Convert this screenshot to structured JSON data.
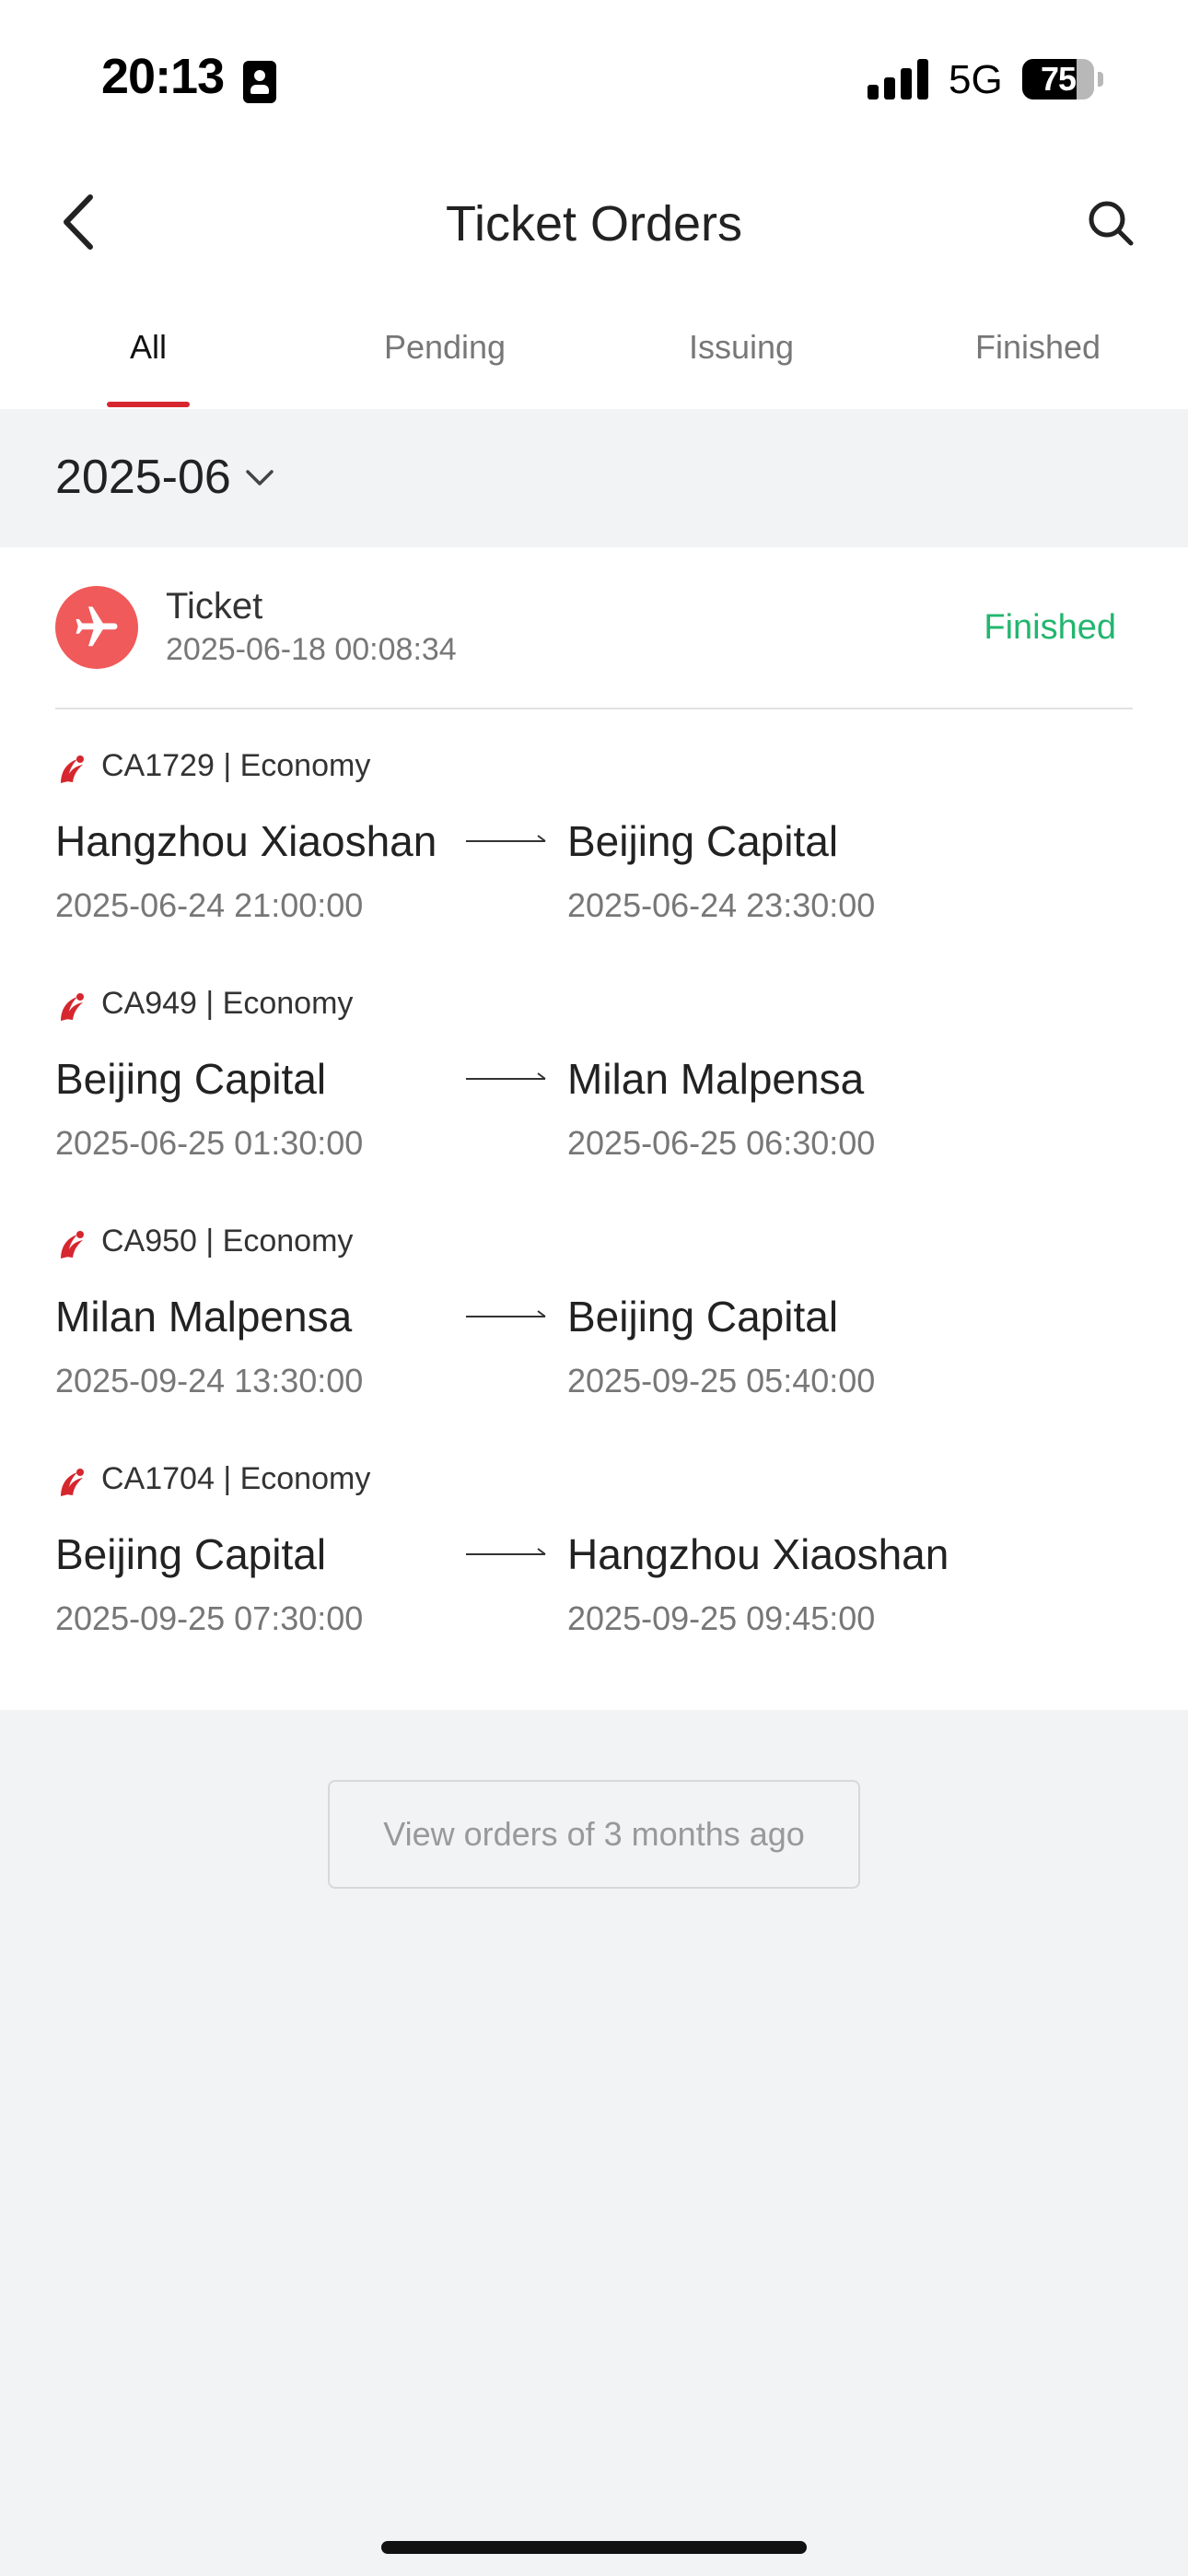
{
  "status_bar": {
    "time": "20:13",
    "network": "5G",
    "battery_level": "75",
    "battery_fraction": 0.75,
    "signal_bars": 4
  },
  "nav": {
    "title": "Ticket Orders",
    "back_icon": "chevron-left-icon",
    "search_icon": "search-icon"
  },
  "tabs": [
    {
      "label": "All",
      "active": true
    },
    {
      "label": "Pending",
      "active": false
    },
    {
      "label": "Issuing",
      "active": false
    },
    {
      "label": "Finished",
      "active": false
    }
  ],
  "month_selector": {
    "value": "2025-06",
    "icon": "chevron-down-icon"
  },
  "order": {
    "icon": "airplane-icon",
    "title": "Ticket",
    "created_time": "2025-06-18 00:08:34",
    "status": "Finished",
    "segments": [
      {
        "flight": "CA1729 | Economy",
        "from": "Hangzhou Xiaoshan",
        "to": "Beijing Capital",
        "dep_time": "2025-06-24 21:00:00",
        "arr_time": "2025-06-24 23:30:00"
      },
      {
        "flight": "CA949 | Economy",
        "from": "Beijing Capital",
        "to": "Milan Malpensa",
        "dep_time": "2025-06-25 01:30:00",
        "arr_time": "2025-06-25 06:30:00"
      },
      {
        "flight": "CA950 | Economy",
        "from": "Milan Malpensa",
        "to": "Beijing Capital",
        "dep_time": "2025-09-24 13:30:00",
        "arr_time": "2025-09-25 05:40:00"
      },
      {
        "flight": "CA1704 | Economy",
        "from": "Beijing Capital",
        "to": "Hangzhou Xiaoshan",
        "dep_time": "2025-09-25 07:30:00",
        "arr_time": "2025-09-25 09:45:00"
      }
    ]
  },
  "view_older_button": "View orders of 3 months ago",
  "colors": {
    "accent_red": "#d6262e",
    "ticket_icon_bg": "#f05a5a",
    "status_green": "#22b66e",
    "page_bg": "#f2f3f5"
  }
}
